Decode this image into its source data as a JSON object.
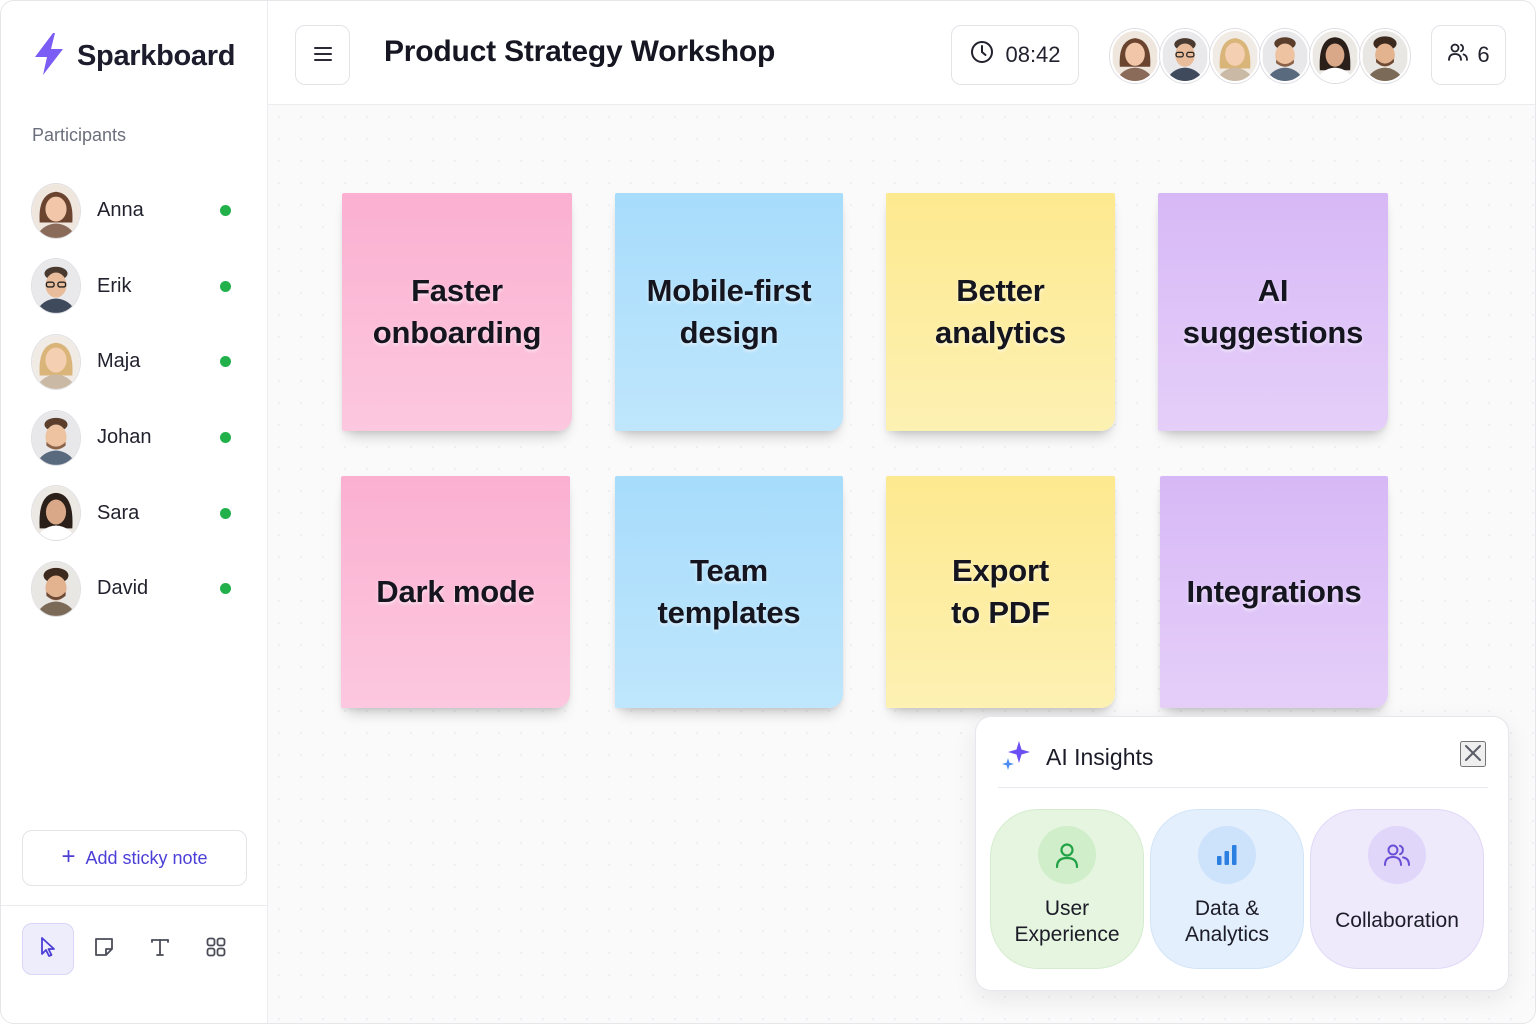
{
  "app": {
    "brand_name": "Sparkboard",
    "accent_color": "#6c4ef5"
  },
  "header": {
    "title": "Product Strategy Workshop",
    "timer": "08:42",
    "participant_count": "6"
  },
  "sidebar": {
    "section_title": "Participants",
    "participants": [
      {
        "name": "Anna",
        "status": "online"
      },
      {
        "name": "Erik",
        "status": "online"
      },
      {
        "name": "Maja",
        "status": "online"
      },
      {
        "name": "Johan",
        "status": "online"
      },
      {
        "name": "Sara",
        "status": "online"
      },
      {
        "name": "David",
        "status": "online"
      }
    ],
    "add_button_label": "Add sticky note",
    "tools": [
      "cursor-icon",
      "sticky-note-icon",
      "text-icon",
      "grid-icon"
    ]
  },
  "notes": [
    {
      "text": "Faster\nonboarding",
      "color": "pink"
    },
    {
      "text": "Mobile-first\ndesign",
      "color": "blue"
    },
    {
      "text": "Better\nanalytics",
      "color": "yellow"
    },
    {
      "text": "AI\nsuggestions",
      "color": "purple"
    },
    {
      "text": "Dark mode",
      "color": "pink"
    },
    {
      "text": "Team\ntemplates",
      "color": "blue"
    },
    {
      "text": "Export\nto PDF",
      "color": "yellow"
    },
    {
      "text": "Integrations",
      "color": "purple"
    }
  ],
  "insights": {
    "title": "AI Insights",
    "categories": [
      {
        "label": "User\nExperience",
        "icon": "user-icon"
      },
      {
        "label": "Data &\nAnalytics",
        "icon": "bar-chart-icon"
      },
      {
        "label": "Collaboration",
        "icon": "team-icon"
      }
    ]
  }
}
